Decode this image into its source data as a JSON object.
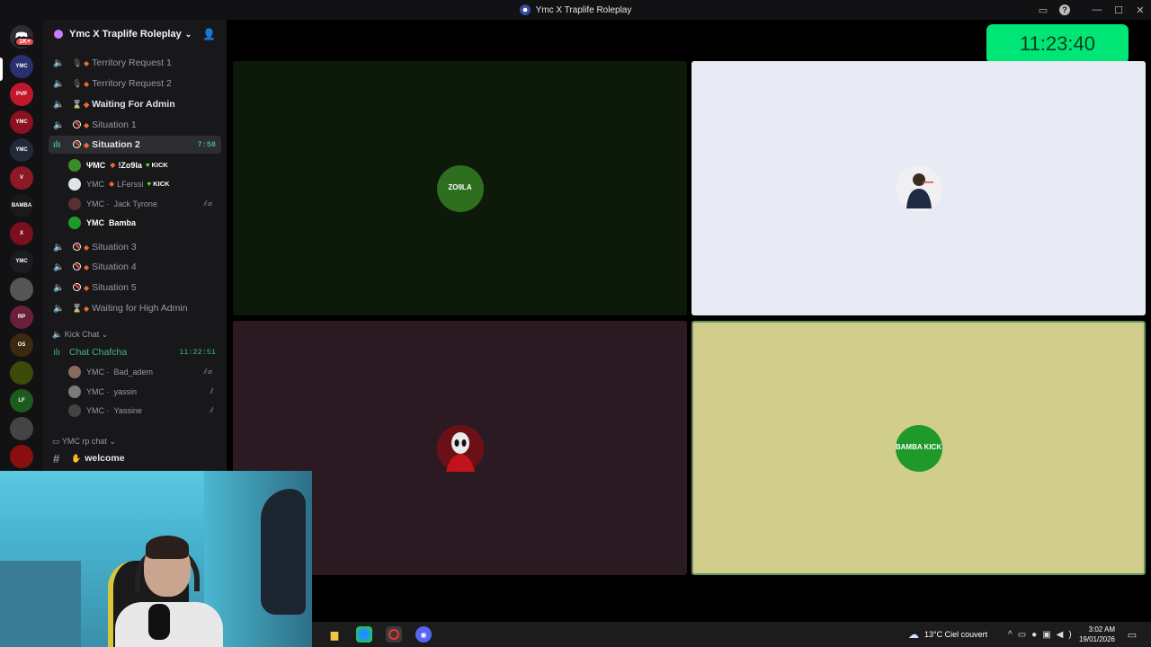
{
  "window": {
    "title": "Ymc X Traplife Roleplay"
  },
  "server": {
    "name": "Ymc X Traplife Roleplay",
    "notification_badge": "1K+",
    "icons": [
      {
        "name": "server-icon-1",
        "color": "#2a2f6e",
        "label": "YMC"
      },
      {
        "name": "server-icon-2",
        "color": "#c0182a",
        "label": "PVP"
      },
      {
        "name": "server-icon-3",
        "color": "#8b1020",
        "label": "YMC"
      },
      {
        "name": "server-icon-4",
        "color": "#222a3a",
        "label": "YMC"
      },
      {
        "name": "server-icon-5",
        "color": "#8b1a24",
        "label": "V"
      },
      {
        "name": "server-icon-6",
        "color": "#1a1a1a",
        "label": "BAMBA"
      },
      {
        "name": "server-icon-7",
        "color": "#7a0f1e",
        "label": "X"
      },
      {
        "name": "server-icon-8",
        "color": "#1b1b22",
        "label": "YMC"
      },
      {
        "name": "server-icon-9",
        "color": "#555",
        "label": ""
      },
      {
        "name": "server-icon-10",
        "color": "#6a1f3a",
        "label": "RP"
      },
      {
        "name": "server-icon-11",
        "color": "#3a2a10",
        "label": "OS"
      },
      {
        "name": "server-icon-12",
        "color": "#3c4a0a",
        "label": ""
      },
      {
        "name": "server-icon-13",
        "color": "#1d5a1d",
        "label": "LF"
      },
      {
        "name": "server-icon-14",
        "color": "#444",
        "label": ""
      },
      {
        "name": "server-icon-15",
        "color": "#8a1010",
        "label": ""
      }
    ]
  },
  "channels": [
    {
      "icon": "mic",
      "name": "Territory Request 1",
      "bold": false
    },
    {
      "icon": "mic",
      "name": "Territory Request 2",
      "bold": false
    },
    {
      "icon": "hourglass",
      "name": "Waiting For Admin",
      "bold": true
    },
    {
      "icon": "no",
      "name": "Situation 1",
      "bold": false
    },
    {
      "icon": "no",
      "name": "Situation 2",
      "bold": true,
      "active": true,
      "timer": "7:58"
    },
    {
      "icon": "no",
      "name": "Situation 3",
      "bold": false
    },
    {
      "icon": "no",
      "name": "Situation 4",
      "bold": false
    },
    {
      "icon": "no",
      "name": "Situation 5",
      "bold": false
    },
    {
      "icon": "hourglass",
      "name": "Waiting for High Admin",
      "bold": false
    }
  ],
  "situation2_users": [
    {
      "prefix": "ΨMC",
      "name": "!Zo9la",
      "kick": "KICK",
      "avatar": "#3d8a2a"
    },
    {
      "prefix": "YMC",
      "name": "LFerssi",
      "kick": "KICK",
      "avatar": "#dfe3ea"
    },
    {
      "prefix": "YMC ·",
      "name": "Jack Tyrone",
      "kick": "",
      "avatar": "#5a2f33"
    },
    {
      "prefix": "YMC",
      "name": "Bamba",
      "kick": "",
      "avatar": "#1f9a2a"
    }
  ],
  "kick_category": "Kick Chat",
  "chat_channel": {
    "name": "Chat Chafcha",
    "timer": "11:22:51"
  },
  "chat_users": [
    {
      "prefix": "YMC ·",
      "name": "Bad_adem",
      "avatar": "#8a6a5a"
    },
    {
      "prefix": "YMC ·",
      "name": "yassin",
      "avatar": "#7a7a7a"
    },
    {
      "prefix": "YMC ·",
      "name": "Yassine",
      "avatar": "#444"
    }
  ],
  "rp_category": "YMC rp chat",
  "text_channel": {
    "name": "welcome"
  },
  "stage": {
    "clock": "11:23:40",
    "tiles": [
      {
        "bg": "#0d1a0a",
        "avatar_color": "#2d6e1f",
        "avatar_label": "ZO9LA"
      },
      {
        "bg": "#e8ebf4",
        "avatar_color": "#f0f0f3",
        "avatar_label": ""
      },
      {
        "bg": "#2b1a21",
        "avatar_color": "#b8141c",
        "avatar_label": ""
      },
      {
        "bg": "#d1ce8b",
        "avatar_color": "#1f9a2a",
        "avatar_label": "BAMBA KICK"
      }
    ]
  },
  "taskbar": {
    "weather": "13°C  Ciel couvert",
    "time": "3:02 AM",
    "date": "19/01/2026"
  }
}
